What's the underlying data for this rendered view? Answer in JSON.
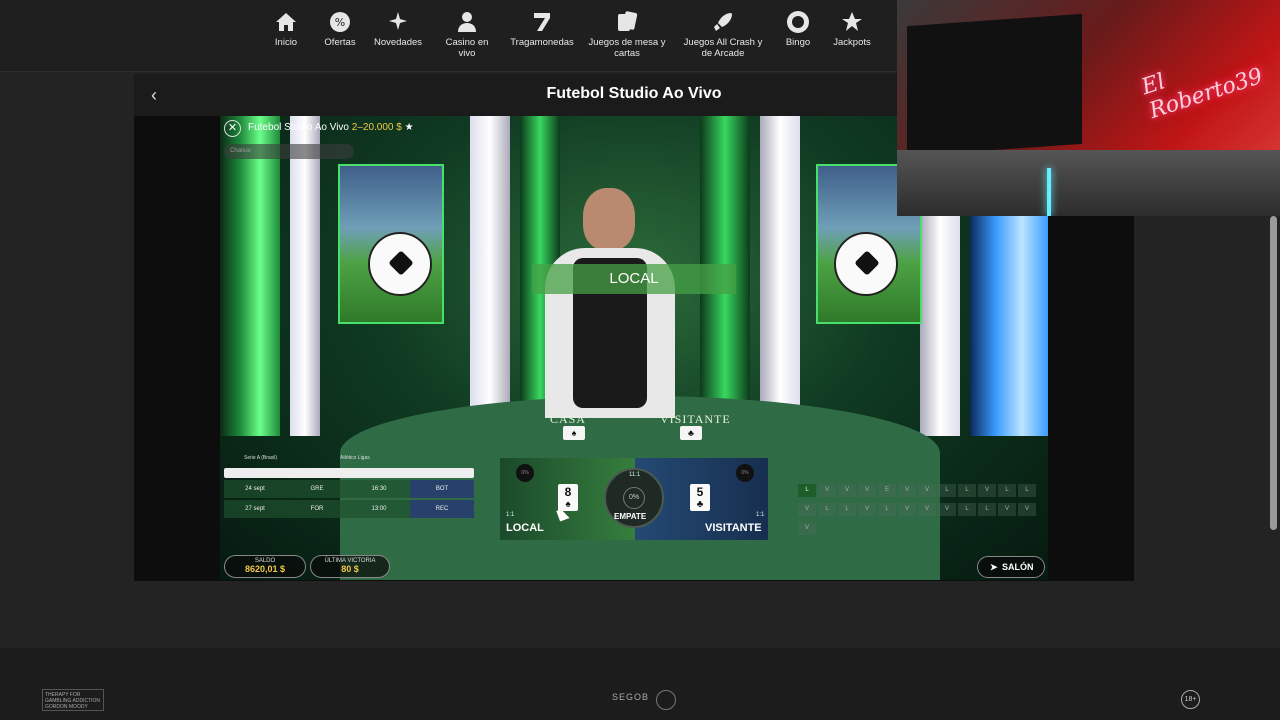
{
  "nav": {
    "items": [
      {
        "label": "Inicio",
        "icon": "home-icon"
      },
      {
        "label": "Ofertas",
        "icon": "percent-badge-icon"
      },
      {
        "label": "Novedades",
        "icon": "sparkles-icon"
      },
      {
        "label": "Casino en vivo",
        "icon": "dealer-icon"
      },
      {
        "label": "Tragamonedas",
        "icon": "slot-seven-icon"
      },
      {
        "label": "Juegos de mesa y cartas",
        "icon": "cards-icon"
      },
      {
        "label": "Juegos All Crash y de Arcade",
        "icon": "rocket-icon"
      },
      {
        "label": "Bingo",
        "icon": "bingo-ball-icon"
      },
      {
        "label": "Jackpots",
        "icon": "stars-icon"
      }
    ]
  },
  "page": {
    "title": "Futebol Studio Ao Vivo"
  },
  "game": {
    "name": "Futebol Studio Ao Vivo",
    "limits": "2–20.000 $",
    "chat_placeholder": "Chatear",
    "banner": "LOCAL",
    "table_home": "CASA",
    "table_away": "VISITANTE",
    "schedule": {
      "league": "Serie A (Brasil)",
      "team": "Atlético Ligas",
      "rows": [
        [
          "24 sept",
          "GRE",
          "16:30",
          "BOT"
        ],
        [
          "27 sept",
          "FOR",
          "13:00",
          "REC"
        ]
      ]
    },
    "bet": {
      "local_label": "LOCAL",
      "local_ratio": "1:1",
      "local_pct": "0%",
      "local_card": "8",
      "local_suit": "♠",
      "draw_label": "EMPATE",
      "draw_ratio": "11:1",
      "draw_pct": "0%",
      "visit_label": "VISITANTE",
      "visit_ratio": "1:1",
      "visit_pct": "0%",
      "visit_card": "5",
      "visit_suit": "♣"
    },
    "road": [
      "L",
      "V",
      "V",
      "V",
      "E",
      "V",
      "V",
      "L",
      "L",
      "V",
      "L",
      "L",
      "V",
      "L",
      "L",
      "V",
      "L",
      "V",
      "V",
      "V",
      "L",
      "L",
      "V",
      "V",
      "V"
    ],
    "balance": {
      "label": "SALDO",
      "value": "8620,01 $"
    },
    "last_win": {
      "label": "ÚLTIMA VICTORIA",
      "value": "80 $"
    },
    "salon_label": "SALÓN"
  },
  "webcam": {
    "neon_text": "El Roberto39"
  },
  "footer": {
    "gambling_logo": "THERAPY FOR GAMBLING ADDICTION GORDON MOODY",
    "segob": "SEGOB",
    "age": "18+"
  }
}
